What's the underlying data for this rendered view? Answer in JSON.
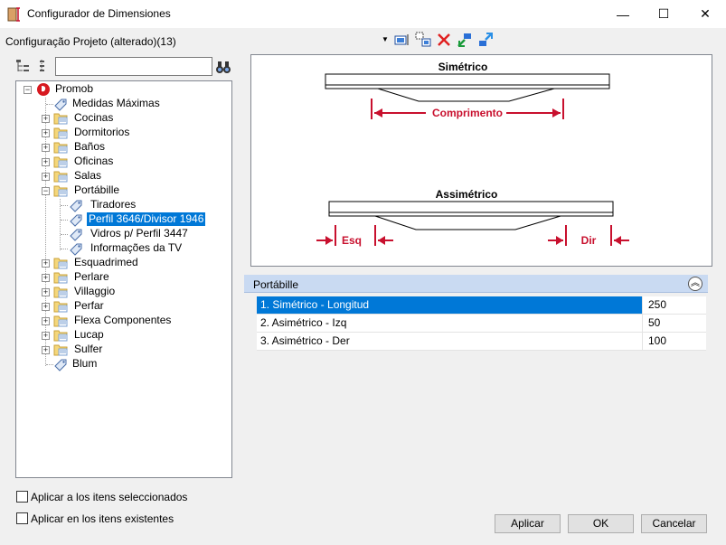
{
  "window": {
    "title": "Configurador de Dimensiones",
    "minimize": "—",
    "maximize": "☐",
    "close": "✕"
  },
  "config_bar": {
    "label": "Configuração Projeto (alterado)(13)",
    "dropdown_arrow": "▼",
    "tools": [
      "edit-icon",
      "copy-icon",
      "delete-icon",
      "import-icon",
      "export-icon"
    ]
  },
  "tree_search": {
    "value": "",
    "binoculars": "binoculars-icon"
  },
  "tree": {
    "items": [
      {
        "label": "Promob",
        "icon": "promob-logo-icon",
        "expanded": true
      },
      {
        "label": "Medidas Máximas",
        "icon": "tag-icon"
      },
      {
        "label": "Cocinas",
        "icon": "folder-icon"
      },
      {
        "label": "Dormitorios",
        "icon": "folder-icon"
      },
      {
        "label": "Baños",
        "icon": "folder-icon"
      },
      {
        "label": "Oficinas",
        "icon": "folder-icon"
      },
      {
        "label": "Salas",
        "icon": "folder-icon"
      },
      {
        "label": "Portábille",
        "icon": "folder-icon",
        "expanded": true
      },
      {
        "label": "Tiradores",
        "icon": "tag-icon"
      },
      {
        "label": "Perfil 3646/Divisor 1946",
        "icon": "tag-icon",
        "selected": true
      },
      {
        "label": "Vidros p/ Perfil 3447",
        "icon": "tag-icon"
      },
      {
        "label": "Informações da TV",
        "icon": "tag-icon"
      },
      {
        "label": "Esquadrimed",
        "icon": "folder-icon"
      },
      {
        "label": "Perlare",
        "icon": "folder-icon"
      },
      {
        "label": "Villaggio",
        "icon": "folder-icon"
      },
      {
        "label": "Perfar",
        "icon": "folder-icon"
      },
      {
        "label": "Flexa Componentes",
        "icon": "folder-icon"
      },
      {
        "label": "Lucap",
        "icon": "folder-icon"
      },
      {
        "label": "Sulfer",
        "icon": "folder-icon"
      },
      {
        "label": "Blum",
        "icon": "tag-icon"
      }
    ]
  },
  "preview": {
    "symmetric_title": "Simétrico",
    "symmetric_dim": "Comprimento",
    "asymmetric_title": "Assimétrico",
    "left_dim": "Esq",
    "right_dim": "Dir",
    "accent": "#c8102e"
  },
  "property_grid": {
    "category": "Portábille",
    "collapse": "︽",
    "rows": [
      {
        "name": "1. Simétrico - Longitud",
        "value": "250",
        "selected": true
      },
      {
        "name": "2. Asimétrico - Izq",
        "value": "50"
      },
      {
        "name": "3. Asimétrico - Der",
        "value": "100"
      }
    ]
  },
  "options": {
    "apply_selected": "Aplicar a los itens seleccionados",
    "apply_existing": "Aplicar en los itens existentes"
  },
  "buttons": {
    "apply": "Aplicar",
    "ok": "OK",
    "cancel": "Cancelar"
  }
}
